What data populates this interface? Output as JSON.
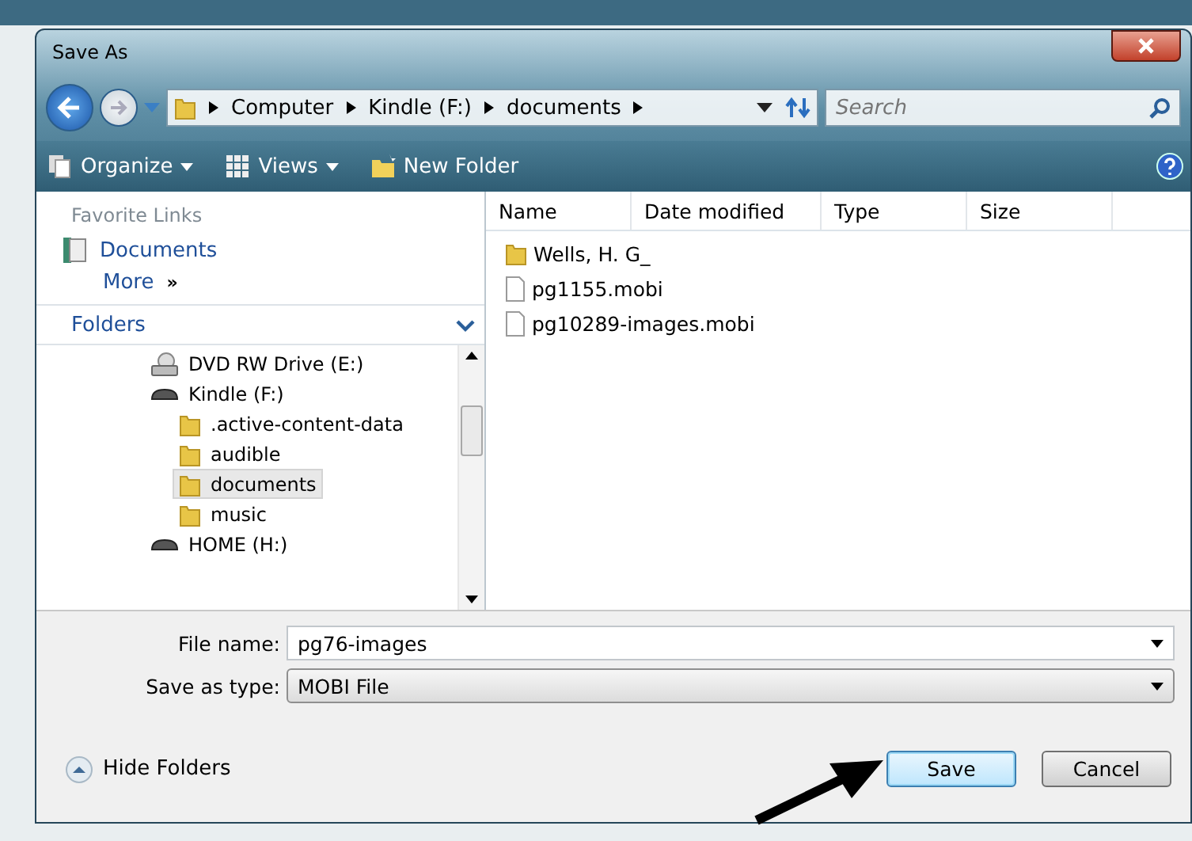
{
  "window": {
    "title": "Save As"
  },
  "address": {
    "crumbs": [
      "Computer",
      "Kindle (F:)",
      "documents"
    ]
  },
  "search": {
    "placeholder": "Search"
  },
  "toolbar": {
    "buttons": [
      {
        "label": "Organize",
        "kind": "menu"
      },
      {
        "label": "Views",
        "kind": "menu"
      },
      {
        "label": "New Folder",
        "kind": "plain"
      }
    ]
  },
  "favorite_links": {
    "heading": "Favorite Links",
    "items": [
      {
        "label": "Documents"
      }
    ],
    "more": "More",
    "more_mark": "»"
  },
  "folders": {
    "heading": "Folders",
    "expanded": true,
    "items": [
      {
        "label": "DVD RW Drive (E:)",
        "kind": "dvd",
        "selected": false
      },
      {
        "label": "Kindle (F:)",
        "kind": "drive",
        "selected": false,
        "children": [
          {
            "label": ".active-content-data",
            "kind": "folder",
            "selected": false
          },
          {
            "label": "audible",
            "kind": "folder",
            "selected": false
          },
          {
            "label": "documents",
            "kind": "folder",
            "selected": true
          },
          {
            "label": "music",
            "kind": "folder",
            "selected": false
          }
        ]
      },
      {
        "label": "HOME (H:)",
        "kind": "drive",
        "selected": false
      }
    ]
  },
  "file_list": {
    "columns": [
      "Name",
      "Date modified",
      "Type",
      "Size"
    ],
    "rows": [
      {
        "name": "Wells, H. G_",
        "kind": "folder"
      },
      {
        "name": "pg1155.mobi",
        "kind": "file"
      },
      {
        "name": "pg10289-images.mobi",
        "kind": "file"
      }
    ]
  },
  "file_name": {
    "label": "File name:",
    "value": "pg76-images"
  },
  "save_as_type": {
    "label": "Save as type:",
    "value": "MOBI File"
  },
  "hide_folders": "Hide Folders",
  "buttons": [
    {
      "label": "Save",
      "default": true
    },
    {
      "label": "Cancel",
      "default": false
    }
  ]
}
